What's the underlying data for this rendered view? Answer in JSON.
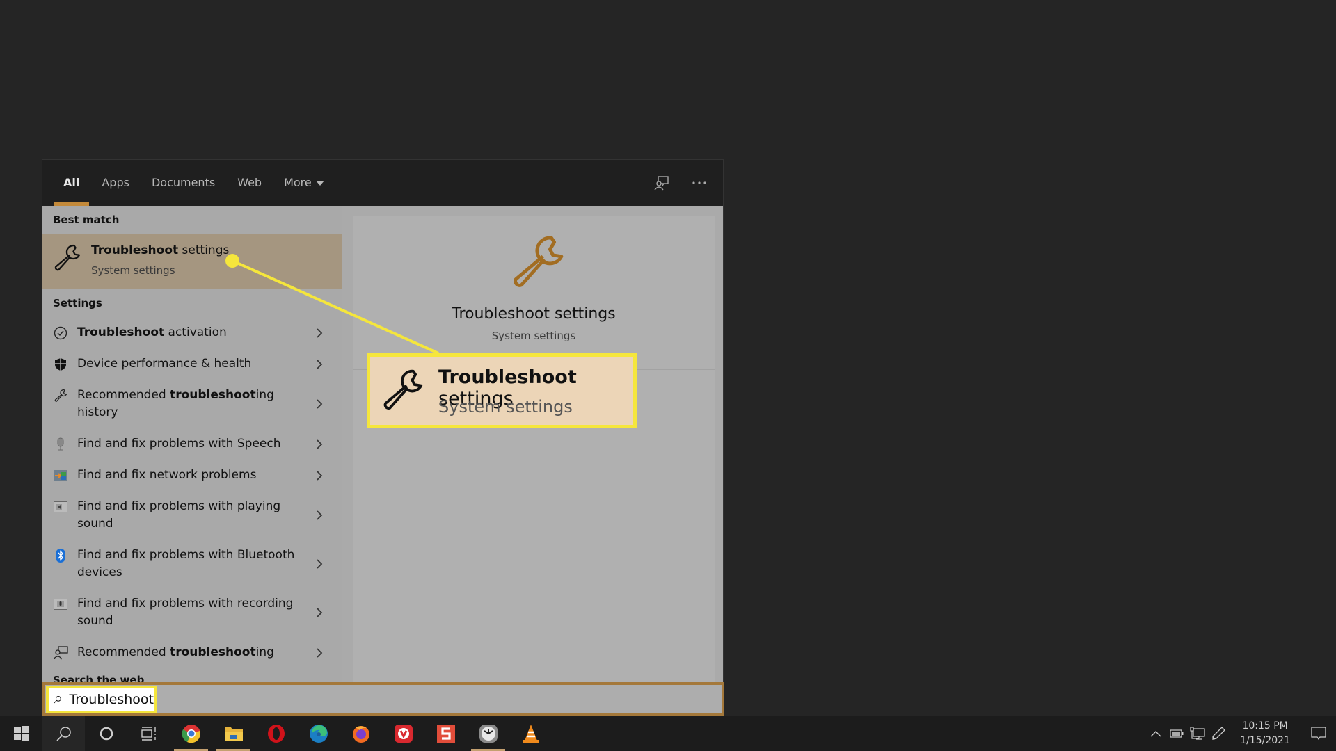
{
  "tabs": [
    {
      "label": "All",
      "active": true
    },
    {
      "label": "Apps"
    },
    {
      "label": "Documents"
    },
    {
      "label": "Web"
    },
    {
      "label": "More"
    }
  ],
  "tab_actions": {
    "feedback_icon": "feedback-icon",
    "more_icon": "ellipsis-icon"
  },
  "best_match": {
    "header": "Best match",
    "title_bold": "Troubleshoot",
    "title_rest": " settings",
    "subtitle": "System settings",
    "icon": "wrench-icon"
  },
  "settings": {
    "header": "Settings",
    "items": [
      {
        "icon": "check-circle-icon",
        "pre": "",
        "bold": "Troubleshoot",
        "post": " activation"
      },
      {
        "icon": "shield-icon",
        "pre": "Device performance & health",
        "bold": "",
        "post": ""
      },
      {
        "icon": "wrench-icon",
        "pre": "Recommended ",
        "bold": "troubleshoot",
        "post": "ing history"
      },
      {
        "icon": "microphone-icon",
        "pre": "Find and fix problems with Speech",
        "bold": "",
        "post": ""
      },
      {
        "icon": "network-icon",
        "pre": "Find and fix network problems",
        "bold": "",
        "post": ""
      },
      {
        "icon": "speaker-icon",
        "pre": "Find and fix problems with playing sound",
        "bold": "",
        "post": ""
      },
      {
        "icon": "bluetooth-icon",
        "pre": "Find and fix problems with Bluetooth devices",
        "bold": "",
        "post": ""
      },
      {
        "icon": "recording-icon",
        "pre": "Find and fix problems with recording sound",
        "bold": "",
        "post": ""
      },
      {
        "icon": "person-feedback-icon",
        "pre": "Recommended ",
        "bold": "troubleshoot",
        "post": "ing"
      }
    ]
  },
  "search_web_header": "Search the web",
  "preview": {
    "title": "Troubleshoot settings",
    "subtitle": "System settings"
  },
  "callout": {
    "title_bold": "Troubleshoot",
    "title_rest": " settings",
    "subtitle": "System settings"
  },
  "search": {
    "value": "Troubleshoot"
  },
  "taskbar": {
    "apps": [
      "start",
      "search",
      "cortana",
      "task-view",
      "chrome",
      "file-explorer",
      "opera",
      "edge",
      "firefox",
      "vivaldi",
      "snagit",
      "clock-app",
      "vlc"
    ],
    "time": "10:15 PM",
    "date": "1/15/2021"
  },
  "colors": {
    "accent": "#c48a3a",
    "highlight": "#f5e63c",
    "best_match_bg": "#a59680"
  }
}
